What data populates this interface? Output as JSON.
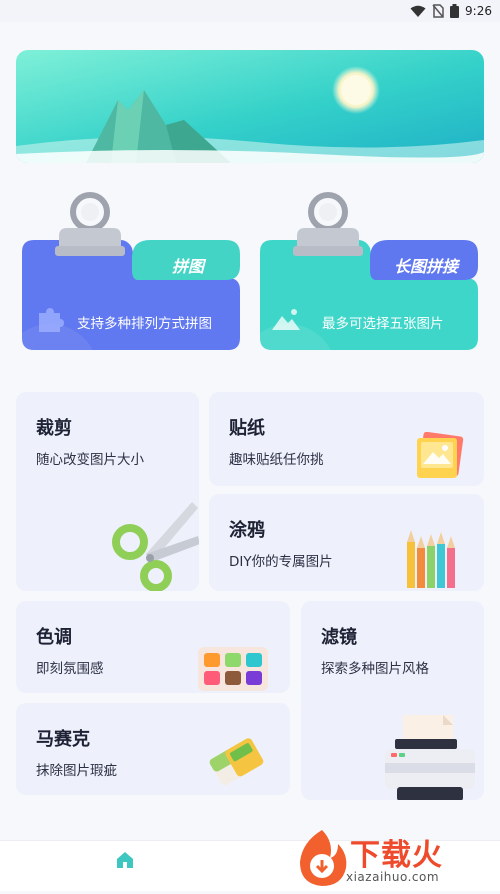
{
  "status_bar": {
    "time": "9:26"
  },
  "features": {
    "collage": {
      "tag": "拼图",
      "desc": "支持多种排列方式拼图",
      "color": "#6078f0"
    },
    "long_image": {
      "tag": "长图拼接",
      "desc": "最多可选择五张图片",
      "color": "#3dd6c8"
    }
  },
  "tools": {
    "crop": {
      "title": "裁剪",
      "sub": "随心改变图片大小"
    },
    "sticker": {
      "title": "贴纸",
      "sub": "趣味贴纸任你挑"
    },
    "doodle": {
      "title": "涂鸦",
      "sub": "DIY你的专属图片"
    },
    "tone": {
      "title": "色调",
      "sub": "即刻氛围感"
    },
    "filter": {
      "title": "滤镜",
      "sub": "探索多种图片风格"
    },
    "mosaic": {
      "title": "马赛克",
      "sub": "抹除图片瑕疵"
    }
  },
  "watermark": {
    "brand": "下载火",
    "site": "xiazaihuo.com",
    "color": "#ee4a2c"
  }
}
